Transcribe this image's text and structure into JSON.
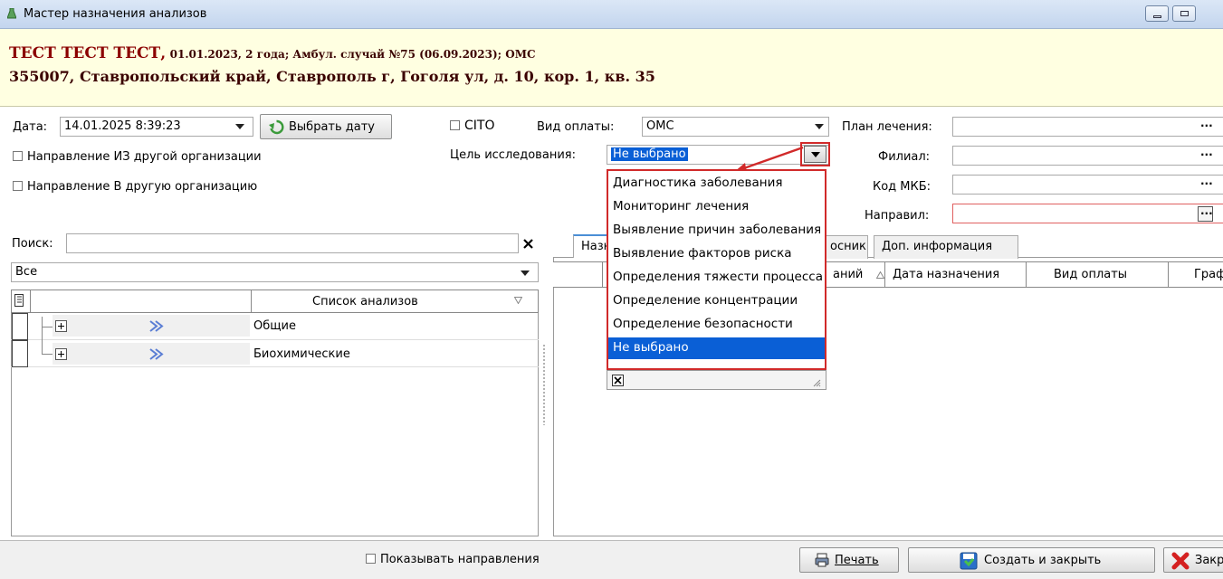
{
  "window": {
    "title": "Мастер назначения анализов"
  },
  "patient": {
    "name": "ТЕСТ ТЕСТ ТЕСТ,",
    "details": "01.01.2023, 2 года; Амбул. случай №75 (06.09.2023); ОМС",
    "address": "355007, Ставропольский край, Ставрополь г, Гоголя ул, д. 10, кор. 1, кв. 35"
  },
  "form": {
    "date_label": "Дата:",
    "date_value": "14.01.2025 8:39:23",
    "pick_date_label": "Выбрать дату",
    "cito_label": "CITO",
    "payment_label": "Вид оплаты:",
    "payment_value": "ОМС",
    "plan_label": "План лечения:",
    "goal_label": "Цель исследования:",
    "goal_value": "Не выбрано",
    "branch_label": "Филиал:",
    "from_org_label": "Направление ИЗ другой организации",
    "to_org_label": "Направление В другую организацию",
    "mkb_label": "Код МКБ:",
    "referrer_label": "Направил:"
  },
  "search": {
    "label": "Поиск:",
    "value": "",
    "filter_value": "Все"
  },
  "analysis_list": {
    "header": "Список анализов",
    "rows": [
      {
        "label": "Общие"
      },
      {
        "label": "Биохимические"
      }
    ]
  },
  "tabs": [
    {
      "label": "Назн"
    },
    {
      "label": "осник"
    },
    {
      "label": "Доп. информация"
    }
  ],
  "right_grid": {
    "columns": [
      "аний",
      "Дата назначения",
      "Вид оплаты",
      "Граф"
    ]
  },
  "goal_dropdown": {
    "options": [
      "Диагностика заболевания",
      "Мониторинг лечения",
      "Выявление причин заболевания",
      "Выявление факторов риска",
      "Определения тяжести процесса",
      "Определение концентрации",
      "Определение безопасности",
      "Не выбрано"
    ],
    "selected_index": 7
  },
  "bottom": {
    "show_referrals_label": "Показывать направления",
    "print_label": "Печать",
    "create_close_label": "Создать и закрыть",
    "close_label": "Закр"
  },
  "colors": {
    "accent_red": "#d12a2a",
    "selection_blue": "#0a5fd6",
    "patient_bg": "#ffffe1"
  }
}
